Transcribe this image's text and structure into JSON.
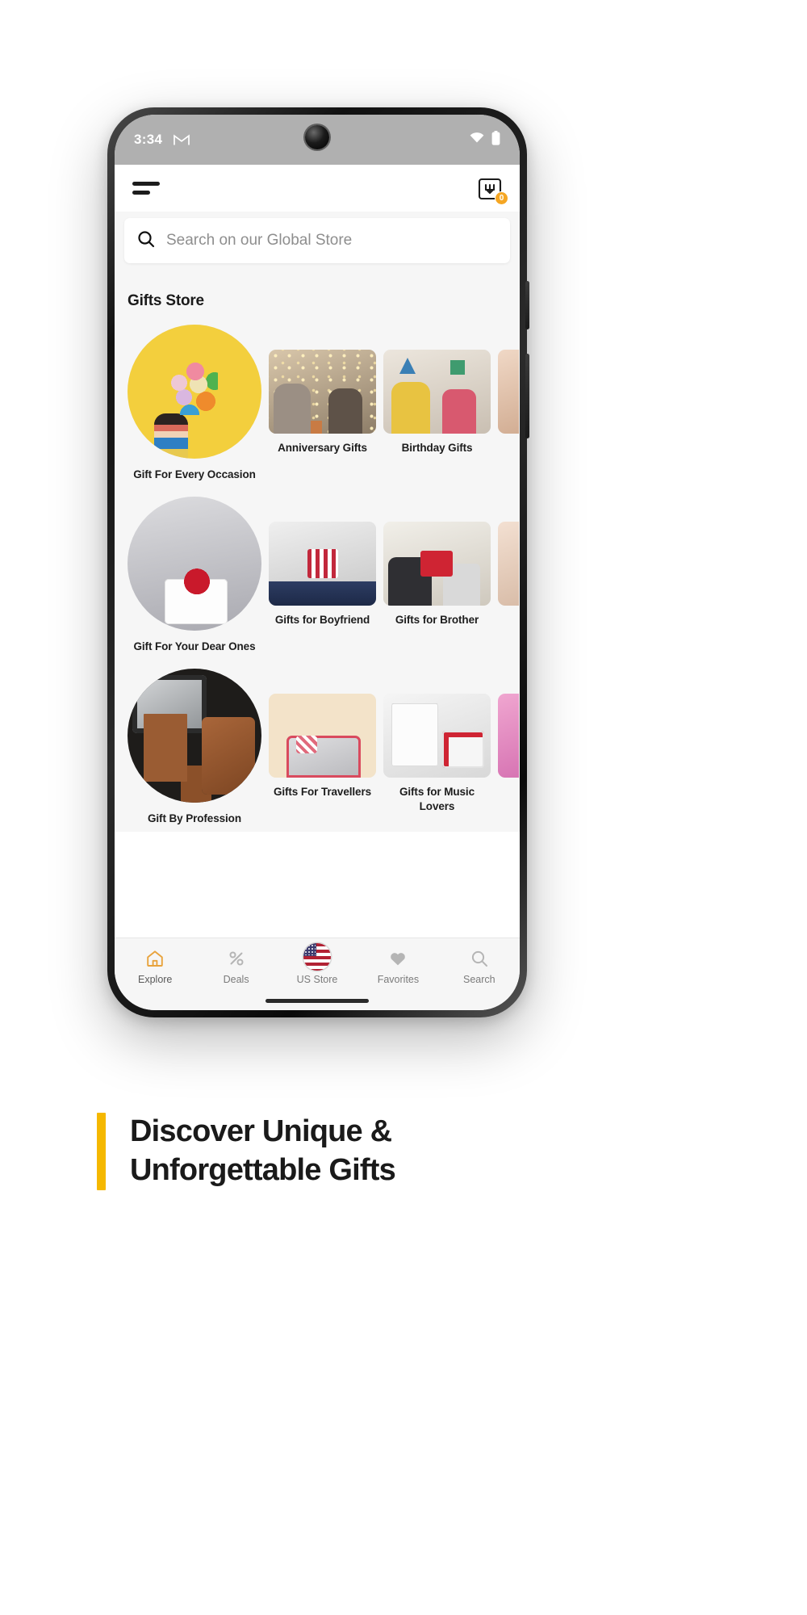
{
  "status_bar": {
    "time": "3:34",
    "gmail_icon": "gmail-icon",
    "wifi_icon": "wifi-icon",
    "battery_icon": "battery-icon"
  },
  "header": {
    "menu_icon": "hamburger-menu-icon",
    "cart_icon": "shopping-cart-icon",
    "cart_badge_count": "0",
    "cart_badge_color": "#f5a623"
  },
  "search": {
    "icon": "search-icon",
    "placeholder": "Search on our Global Store",
    "value": ""
  },
  "main": {
    "section_title": "Gifts Store",
    "rows": [
      {
        "big": {
          "label": "Gift For Every Occasion",
          "image": "p-balloons"
        },
        "items": [
          {
            "label": "Anniversary Gifts",
            "image": "p-anniversary"
          },
          {
            "label": "Birthday Gifts",
            "image": "p-birthday"
          }
        ],
        "peek": "p-generic-a"
      },
      {
        "big": {
          "label": "Gift For Your Dear Ones",
          "image": "p-dear"
        },
        "items": [
          {
            "label": "Gifts for Boyfriend",
            "image": "p-boyfriend"
          },
          {
            "label": "Gifts for Brother",
            "image": "p-brother"
          }
        ],
        "peek": "p-generic-b"
      },
      {
        "big": {
          "label": "Gift By Profession",
          "image": "p-profession"
        },
        "items": [
          {
            "label": "Gifts For Travellers",
            "image": "p-travellers"
          },
          {
            "label": "Gifts for Music Lovers",
            "image": "p-music"
          }
        ],
        "peek": "p-pink"
      }
    ]
  },
  "bottom_nav": {
    "items": [
      {
        "label": "Explore",
        "icon": "home-icon",
        "active": true
      },
      {
        "label": "Deals",
        "icon": "percent-icon",
        "active": false
      },
      {
        "label": "US Store",
        "icon": "us-flag-icon",
        "active": false
      },
      {
        "label": "Favorites",
        "icon": "heart-icon",
        "active": false
      },
      {
        "label": "Search",
        "icon": "search-icon",
        "active": false
      }
    ],
    "active_color": "#e8a33d"
  },
  "tagline": {
    "line1": "Discover Unique &",
    "line2": "Unforgettable Gifts",
    "accent_color": "#f5b800"
  }
}
